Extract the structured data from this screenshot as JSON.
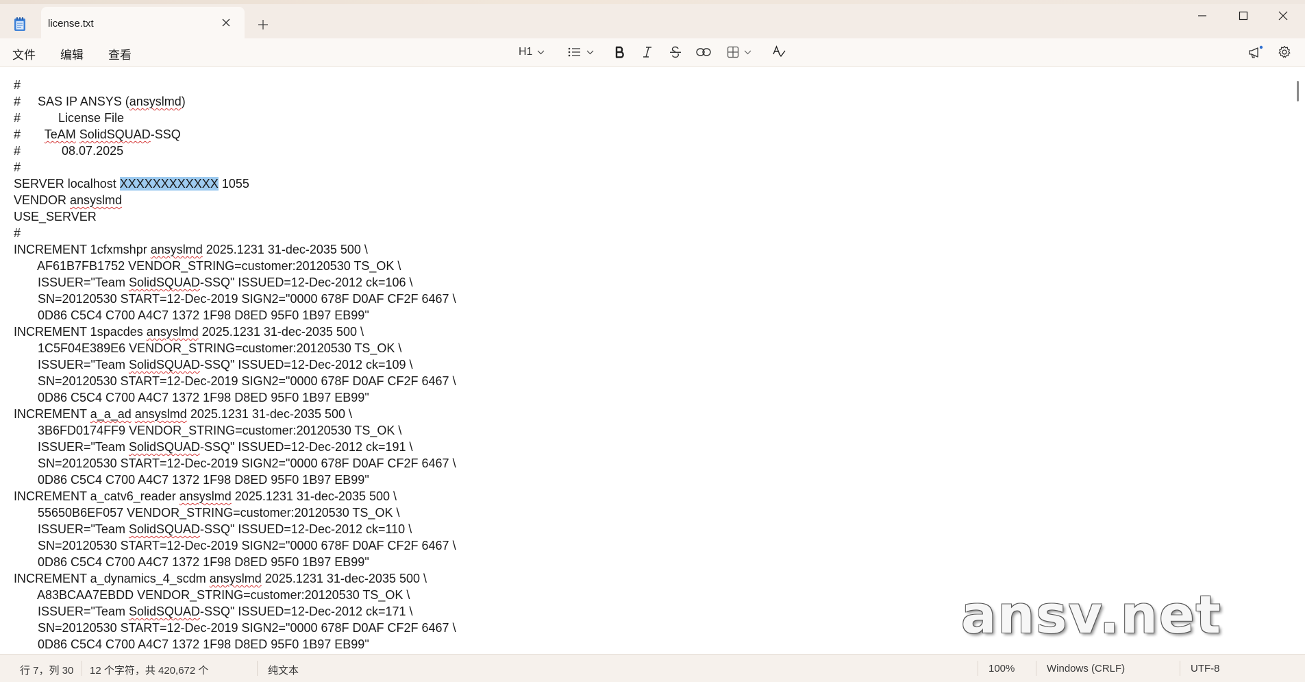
{
  "tab": {
    "title": "license.txt"
  },
  "menu": {
    "file": "文件",
    "edit": "编辑",
    "view": "查看"
  },
  "toolbar": {
    "heading": "H1"
  },
  "editor": {
    "lines": [
      {
        "segments": [
          {
            "t": "#"
          }
        ]
      },
      {
        "segments": [
          {
            "t": "#     SAS IP ANSYS ("
          },
          {
            "t": "ansyslmd",
            "sq": true
          },
          {
            "t": ")"
          }
        ]
      },
      {
        "segments": [
          {
            "t": "#           License File"
          }
        ]
      },
      {
        "segments": [
          {
            "t": "#       "
          },
          {
            "t": "TeAM",
            "sq": true
          },
          {
            "t": " "
          },
          {
            "t": "SolidSQUAD",
            "sq": true
          },
          {
            "t": "-SSQ"
          }
        ]
      },
      {
        "segments": [
          {
            "t": "#            08.07.2025"
          }
        ]
      },
      {
        "segments": [
          {
            "t": "#"
          }
        ]
      },
      {
        "segments": [
          {
            "t": "SERVER localhost "
          },
          {
            "t": "XXXXXXXXXXXX",
            "sel": true
          },
          {
            "t": " 1055"
          }
        ]
      },
      {
        "segments": [
          {
            "t": "VENDOR "
          },
          {
            "t": "ansyslmd",
            "sq": true
          }
        ]
      },
      {
        "segments": [
          {
            "t": "USE_SERVER"
          }
        ]
      },
      {
        "segments": [
          {
            "t": "#"
          }
        ]
      },
      {
        "segments": [
          {
            "t": "INCREMENT 1cfxmshpr "
          },
          {
            "t": "ansyslmd",
            "sq": true
          },
          {
            "t": " 2025.1231 31-dec-2035 500 \\"
          }
        ]
      },
      {
        "segments": [
          {
            "t": "       AF61B7FB1752 VENDOR_STRING=customer:20120530 TS_OK \\"
          }
        ]
      },
      {
        "segments": [
          {
            "t": "       ISSUER=\"Team "
          },
          {
            "t": "SolidSQUAD",
            "sq": true
          },
          {
            "t": "-SSQ\" ISSUED=12-Dec-2012 ck=106 \\"
          }
        ]
      },
      {
        "segments": [
          {
            "t": "       SN=20120530 START=12-Dec-2019 SIGN2=\"0000 678F D0AF CF2F 6467 \\"
          }
        ]
      },
      {
        "segments": [
          {
            "t": "       0D86 C5C4 C700 A4C7 1372 1F98 D8ED 95F0 1B97 EB99\""
          }
        ]
      },
      {
        "segments": [
          {
            "t": "INCREMENT 1spacdes "
          },
          {
            "t": "ansyslmd",
            "sq": true
          },
          {
            "t": " 2025.1231 31-dec-2035 500 \\"
          }
        ]
      },
      {
        "segments": [
          {
            "t": "       1C5F04E389E6 VENDOR_STRING=customer:20120530 TS_OK \\"
          }
        ]
      },
      {
        "segments": [
          {
            "t": "       ISSUER=\"Team "
          },
          {
            "t": "SolidSQUAD",
            "sq": true
          },
          {
            "t": "-SSQ\" ISSUED=12-Dec-2012 ck=109 \\"
          }
        ]
      },
      {
        "segments": [
          {
            "t": "       SN=20120530 START=12-Dec-2019 SIGN2=\"0000 678F D0AF CF2F 6467 \\"
          }
        ]
      },
      {
        "segments": [
          {
            "t": "       0D86 C5C4 C700 A4C7 1372 1F98 D8ED 95F0 1B97 EB99\""
          }
        ]
      },
      {
        "segments": [
          {
            "t": "INCREMENT "
          },
          {
            "t": "a_a_ad",
            "sq": true
          },
          {
            "t": " "
          },
          {
            "t": "ansyslmd",
            "sq": true
          },
          {
            "t": " 2025.1231 31-dec-2035 500 \\"
          }
        ]
      },
      {
        "segments": [
          {
            "t": "       3B6FD0174FF9 VENDOR_STRING=customer:20120530 TS_OK \\"
          }
        ]
      },
      {
        "segments": [
          {
            "t": "       ISSUER=\"Team "
          },
          {
            "t": "SolidSQUAD",
            "sq": true
          },
          {
            "t": "-SSQ\" ISSUED=12-Dec-2012 ck=191 \\"
          }
        ]
      },
      {
        "segments": [
          {
            "t": "       SN=20120530 START=12-Dec-2019 SIGN2=\"0000 678F D0AF CF2F 6467 \\"
          }
        ]
      },
      {
        "segments": [
          {
            "t": "       0D86 C5C4 C700 A4C7 1372 1F98 D8ED 95F0 1B97 EB99\""
          }
        ]
      },
      {
        "segments": [
          {
            "t": "INCREMENT a_catv6_reader "
          },
          {
            "t": "ansyslmd",
            "sq": true
          },
          {
            "t": " 2025.1231 31-dec-2035 500 \\"
          }
        ]
      },
      {
        "segments": [
          {
            "t": "       55650B6EF057 VENDOR_STRING=customer:20120530 TS_OK \\"
          }
        ]
      },
      {
        "segments": [
          {
            "t": "       ISSUER=\"Team "
          },
          {
            "t": "SolidSQUAD",
            "sq": true
          },
          {
            "t": "-SSQ\" ISSUED=12-Dec-2012 ck=110 \\"
          }
        ]
      },
      {
        "segments": [
          {
            "t": "       SN=20120530 START=12-Dec-2019 SIGN2=\"0000 678F D0AF CF2F 6467 \\"
          }
        ]
      },
      {
        "segments": [
          {
            "t": "       0D86 C5C4 C700 A4C7 1372 1F98 D8ED 95F0 1B97 EB99\""
          }
        ]
      },
      {
        "segments": [
          {
            "t": "INCREMENT a_dynamics_4_scdm "
          },
          {
            "t": "ansyslmd",
            "sq": true
          },
          {
            "t": " 2025.1231 31-dec-2035 500 \\"
          }
        ]
      },
      {
        "segments": [
          {
            "t": "       A83BCAA7EBDD VENDOR_STRING=customer:20120530 TS_OK \\"
          }
        ]
      },
      {
        "segments": [
          {
            "t": "       ISSUER=\"Team "
          },
          {
            "t": "SolidSQUAD",
            "sq": true
          },
          {
            "t": "-SSQ\" ISSUED=12-Dec-2012 ck=171 \\"
          }
        ]
      },
      {
        "segments": [
          {
            "t": "       SN=20120530 START=12-Dec-2019 SIGN2=\"0000 678F D0AF CF2F 6467 \\"
          }
        ]
      },
      {
        "segments": [
          {
            "t": "       0D86 C5C4 C700 A4C7 1372 1F98 D8ED 95F0 1B97 EB99\""
          }
        ]
      }
    ]
  },
  "watermark": "ansv.net",
  "status": {
    "position": "行 7，列 30",
    "chars": "12 个字符，共 420,672 个",
    "format": "纯文本",
    "zoom": "100%",
    "line_ending": "Windows (CRLF)",
    "encoding": "UTF-8"
  }
}
